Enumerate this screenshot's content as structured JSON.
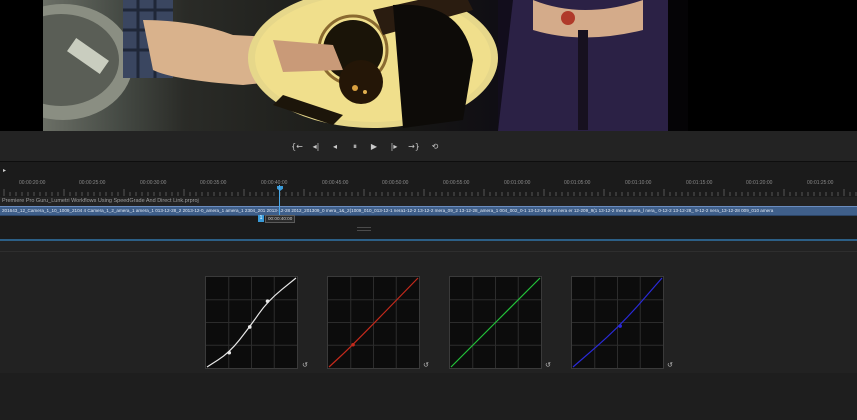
{
  "project": {
    "title": "Premiere Pro Guru_Lumetri Workflows Using SpeedGrade And Direct Link.prproj"
  },
  "viewer": {
    "frame_icon": "video-frame"
  },
  "transport": {
    "buttons": [
      {
        "name": "go-to-in-button",
        "glyph": "{←",
        "icon": "go-to-in-icon"
      },
      {
        "name": "step-back-edit-button",
        "glyph": "◂|",
        "icon": "step-back-edit-icon"
      },
      {
        "name": "step-back-button",
        "glyph": "◂",
        "icon": "step-back-icon"
      },
      {
        "name": "stop-button",
        "glyph": "⏸",
        "icon": "pause-icon"
      },
      {
        "name": "play-button",
        "glyph": "▶",
        "icon": "play-icon"
      },
      {
        "name": "step-forward-button",
        "glyph": "|▸",
        "icon": "step-forward-icon"
      },
      {
        "name": "go-to-out-button",
        "glyph": "→}",
        "icon": "go-to-out-icon"
      },
      {
        "name": "loop-button",
        "glyph": "⟲",
        "icon": "loop-icon"
      }
    ]
  },
  "timeline": {
    "play_glyph": "▸",
    "ruler_labels": [
      "00:00:20:00",
      "00:00:25:00",
      "00:00:30:00",
      "00:00:35:00",
      "00:00:40:00",
      "00:00:45:00",
      "00:00:50:00",
      "00:00:55:00",
      "00:01:00:00",
      "00:01:05:00",
      "00:01:10:00",
      "00:01:15:00",
      "00:01:20:00",
      "00:01:25:00"
    ],
    "clip_names": "201643_12_Camera_1_10_1009_2104 4 Camera_1_2_amera_1 amera_1 013-12-28_2 2013-12-0_amera_1 amera_1 2304_201 2013-12-28 2012_201309_0 mera_1&_2(1009_010_013-12-1 nera1-12-2 13-12-2 mera_09_2 13-12-28_amera_1 004_002_0-1 13-12-28 er et nera er 12-209_9(1 13-12-2 mera amera_l nera_ 0-12-2 13-12-28_ 9-12-2 nera_13-12-28 009_010 amera",
    "marker_label": "1",
    "current_timecode": "00:00:40:00"
  },
  "curves": {
    "reset_glyph": "↺",
    "channels": [
      {
        "name": "master",
        "color": "#e8e8e8",
        "points": [
          [
            0,
            0
          ],
          [
            0.25,
            0.16
          ],
          [
            0.48,
            0.45
          ],
          [
            0.68,
            0.74
          ],
          [
            1,
            1
          ]
        ]
      },
      {
        "name": "red",
        "color": "#c42a1c",
        "points": [
          [
            0,
            0
          ],
          [
            0.27,
            0.25
          ],
          [
            1,
            1
          ]
        ]
      },
      {
        "name": "green",
        "color": "#23c23a",
        "points": [
          [
            0,
            0
          ],
          [
            1,
            1
          ]
        ]
      },
      {
        "name": "blue",
        "color": "#2a2ad8",
        "points": [
          [
            0,
            0
          ],
          [
            0.53,
            0.46
          ],
          [
            1,
            1
          ]
        ]
      }
    ]
  }
}
